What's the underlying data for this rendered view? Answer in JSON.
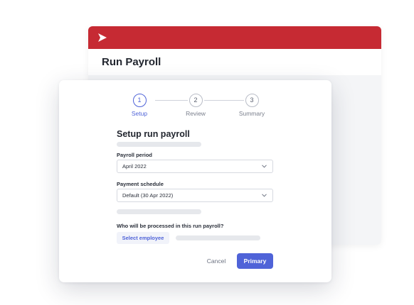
{
  "app": {
    "title": "Run Payroll",
    "brand_color": "#c62a33",
    "logo_icon": "chevron-right-logo"
  },
  "modal": {
    "steps": [
      {
        "number": "1",
        "label": "Setup",
        "active": true
      },
      {
        "number": "2",
        "label": "Review",
        "active": false
      },
      {
        "number": "3",
        "label": "Summary",
        "active": false
      }
    ],
    "title": "Setup run payroll",
    "payroll_period": {
      "label": "Payroll period",
      "value": "April 2022"
    },
    "payment_schedule": {
      "label": "Payment schedule",
      "value": "Default (30 Apr 2022)"
    },
    "question": "Who will be processed in this run payroll?",
    "select_employee_label": "Select employee",
    "cancel_label": "Cancel",
    "primary_label": "Primary",
    "accent_color": "#4f63d8"
  }
}
